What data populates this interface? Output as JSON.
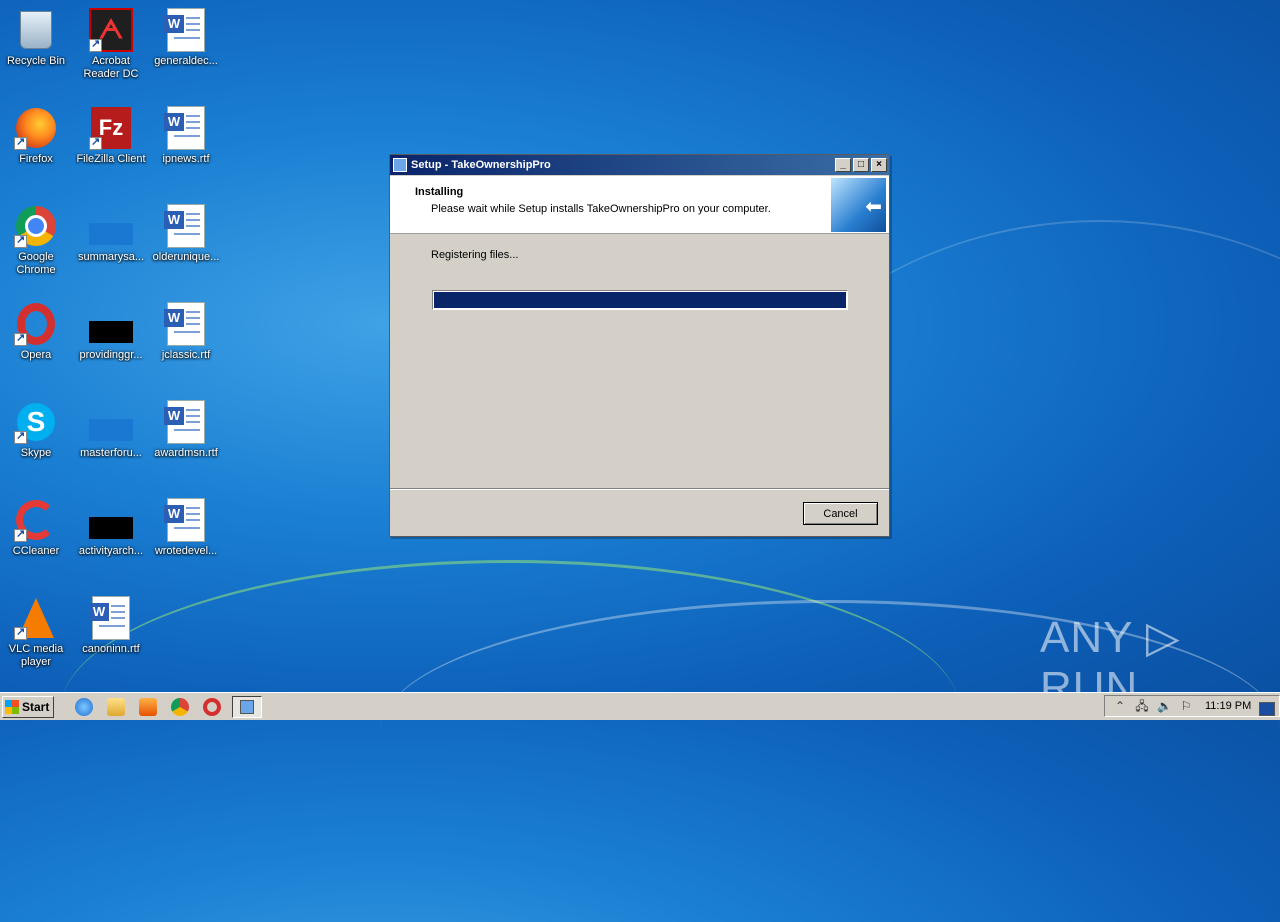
{
  "desktop": {
    "icons": [
      {
        "label": "Recycle Bin"
      },
      {
        "label": "Acrobat Reader DC"
      },
      {
        "label": "generaldec..."
      },
      {
        "label": "Firefox"
      },
      {
        "label": "FileZilla Client"
      },
      {
        "label": "ipnews.rtf"
      },
      {
        "label": "Google Chrome"
      },
      {
        "label": "summarysa..."
      },
      {
        "label": "olderunique..."
      },
      {
        "label": "Opera"
      },
      {
        "label": "providinggr..."
      },
      {
        "label": "jclassic.rtf"
      },
      {
        "label": "Skype"
      },
      {
        "label": "masterforu..."
      },
      {
        "label": "awardmsn.rtf"
      },
      {
        "label": "CCleaner"
      },
      {
        "label": "activityarch..."
      },
      {
        "label": "wrotedevel..."
      },
      {
        "label": "VLC media player"
      },
      {
        "label": "canoninn.rtf"
      }
    ]
  },
  "dialog": {
    "title": "Setup - TakeOwnershipPro",
    "heading": "Installing",
    "subheading": "Please wait while Setup installs TakeOwnershipPro on your computer.",
    "status": "Registering files...",
    "progress": 1.0,
    "cancel_label": "Cancel",
    "minimize": "_",
    "maximize": "□",
    "close": "×"
  },
  "watermark": "ANY ▷ RUN",
  "taskbar": {
    "start_label": "Start",
    "clock": "11:19 PM"
  },
  "icons": {
    "recycle-bin": "recycle-bin-icon",
    "acrobat": "acrobat-icon",
    "word-doc": "word-document-icon",
    "firefox": "firefox-icon",
    "filezilla": "filezilla-icon",
    "chrome": "chrome-icon",
    "opera": "opera-icon",
    "skype": "skype-icon",
    "ccleaner": "ccleaner-icon",
    "vlc": "vlc-icon"
  }
}
